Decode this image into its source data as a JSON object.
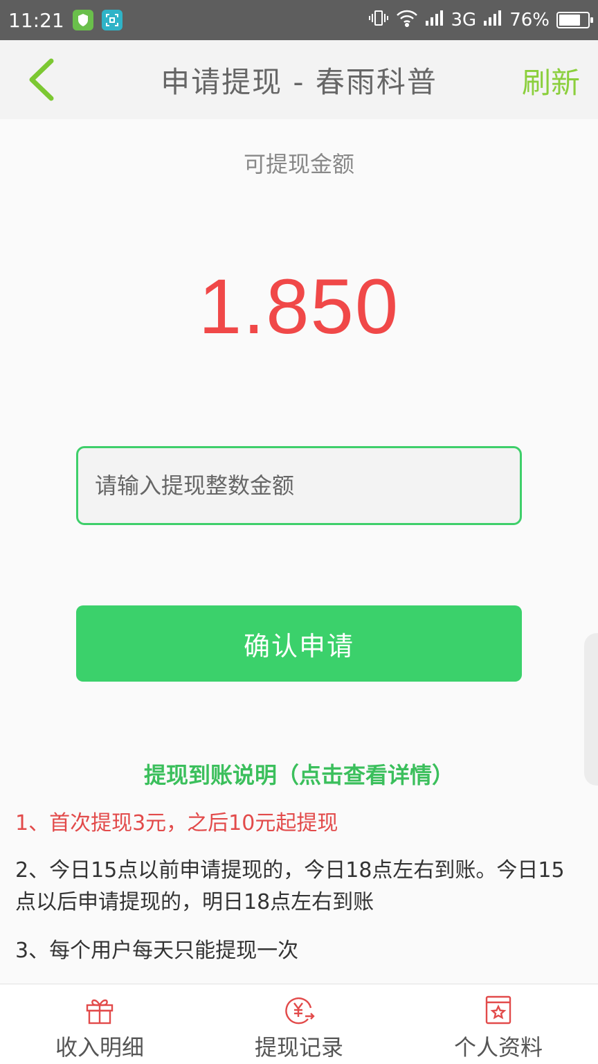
{
  "status_bar": {
    "time": "11:21",
    "network": "3G",
    "battery": "76%",
    "battery_level": 0.76
  },
  "navbar": {
    "title": "申请提现 - 春雨科普",
    "refresh_label": "刷新",
    "accent_color": "#8bcf3c"
  },
  "balance": {
    "label": "可提现金额",
    "value": "1.850",
    "color": "#f04848"
  },
  "form": {
    "amount_placeholder": "请输入提现整数金额",
    "confirm_label": "确认申请",
    "button_color": "#3bd16b"
  },
  "notes": {
    "title": "提现到账说明（点击查看详情）",
    "items": [
      "1、首次提现3元，之后10元起提现",
      "2、今日15点以前申请提现的，今日18点左右到账。今日15点以后申请提现的，明日18点左右到账",
      "3、每个用户每天只能提现一次"
    ]
  },
  "tabbar": {
    "tabs": [
      {
        "label": "收入明细",
        "icon": "gift-icon"
      },
      {
        "label": "提现记录",
        "icon": "yuan-transfer-icon"
      },
      {
        "label": "个人资料",
        "icon": "star-card-icon"
      }
    ],
    "icon_color": "#e24a4a"
  }
}
